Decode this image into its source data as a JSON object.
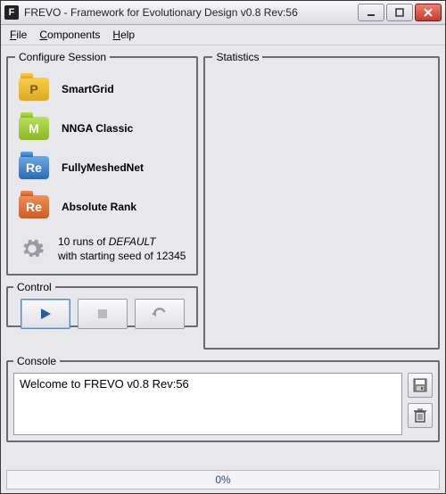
{
  "window": {
    "icon_letter": "F",
    "title": "FREVO - Framework for Evolutionary Design v0.8 Rev:56"
  },
  "menu": {
    "file": "File",
    "components": "Components",
    "help": "Help"
  },
  "panels": {
    "configure": "Configure Session",
    "statistics": "Statistics",
    "control": "Control",
    "console": "Console"
  },
  "session": {
    "items": [
      {
        "label": "SmartGrid",
        "glyph": "P"
      },
      {
        "label": "NNGA Classic",
        "glyph": "M"
      },
      {
        "label": "FullyMeshedNet",
        "glyph": "Re"
      },
      {
        "label": "Absolute Rank",
        "glyph": "Re"
      }
    ],
    "runs_line1_prefix": "10 runs of ",
    "runs_line1_em": "DEFAULT",
    "runs_line2": "with starting seed of 12345"
  },
  "console": {
    "text": "Welcome to FREVO v0.8 Rev:56"
  },
  "progress": {
    "text": "0%"
  }
}
